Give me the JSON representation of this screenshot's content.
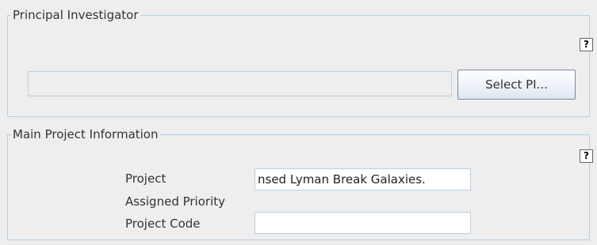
{
  "pi_section": {
    "title": "Principal Investigator",
    "help_label": "?",
    "pi_value": "",
    "select_button": "Select PI..."
  },
  "main_section": {
    "title": "Main Project Information",
    "help_label": "?",
    "project_label": "Project",
    "project_value": "nsed Lyman Break Galaxies.",
    "priority_label": "Assigned Priority",
    "priority_value": "",
    "code_label": "Project Code",
    "code_value": ""
  }
}
